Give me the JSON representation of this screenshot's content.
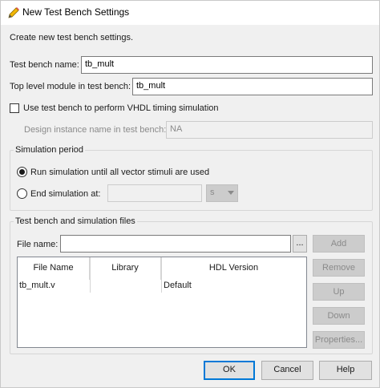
{
  "window": {
    "title": "New Test Bench Settings"
  },
  "intro": "Create new test bench settings.",
  "fields": {
    "test_bench_name_label": "Test bench name:",
    "test_bench_name_value": "tb_mult",
    "top_level_label": "Top level module in test bench:",
    "top_level_value": "tb_mult",
    "vhdl_timing_label": "Use test bench to perform VHDL timing simulation",
    "design_instance_label": "Design instance name in test bench:",
    "design_instance_value": "NA"
  },
  "simulation_period": {
    "title": "Simulation period",
    "run_all_label": "Run simulation until all vector stimuli are used",
    "end_at_label": "End simulation at:",
    "end_at_value": "",
    "unit": "s",
    "selected": "run_all"
  },
  "files": {
    "title": "Test bench and simulation files",
    "file_name_label": "File name:",
    "file_name_value": "",
    "browse_label": "...",
    "columns": [
      "File Name",
      "Library",
      "HDL Version"
    ],
    "rows": [
      {
        "file": "tb_mult.v",
        "library": "",
        "hdl": "Default"
      }
    ],
    "buttons": {
      "add": "Add",
      "remove": "Remove",
      "up": "Up",
      "down": "Down",
      "properties": "Properties..."
    }
  },
  "footer": {
    "ok": "OK",
    "cancel": "Cancel",
    "help": "Help"
  }
}
